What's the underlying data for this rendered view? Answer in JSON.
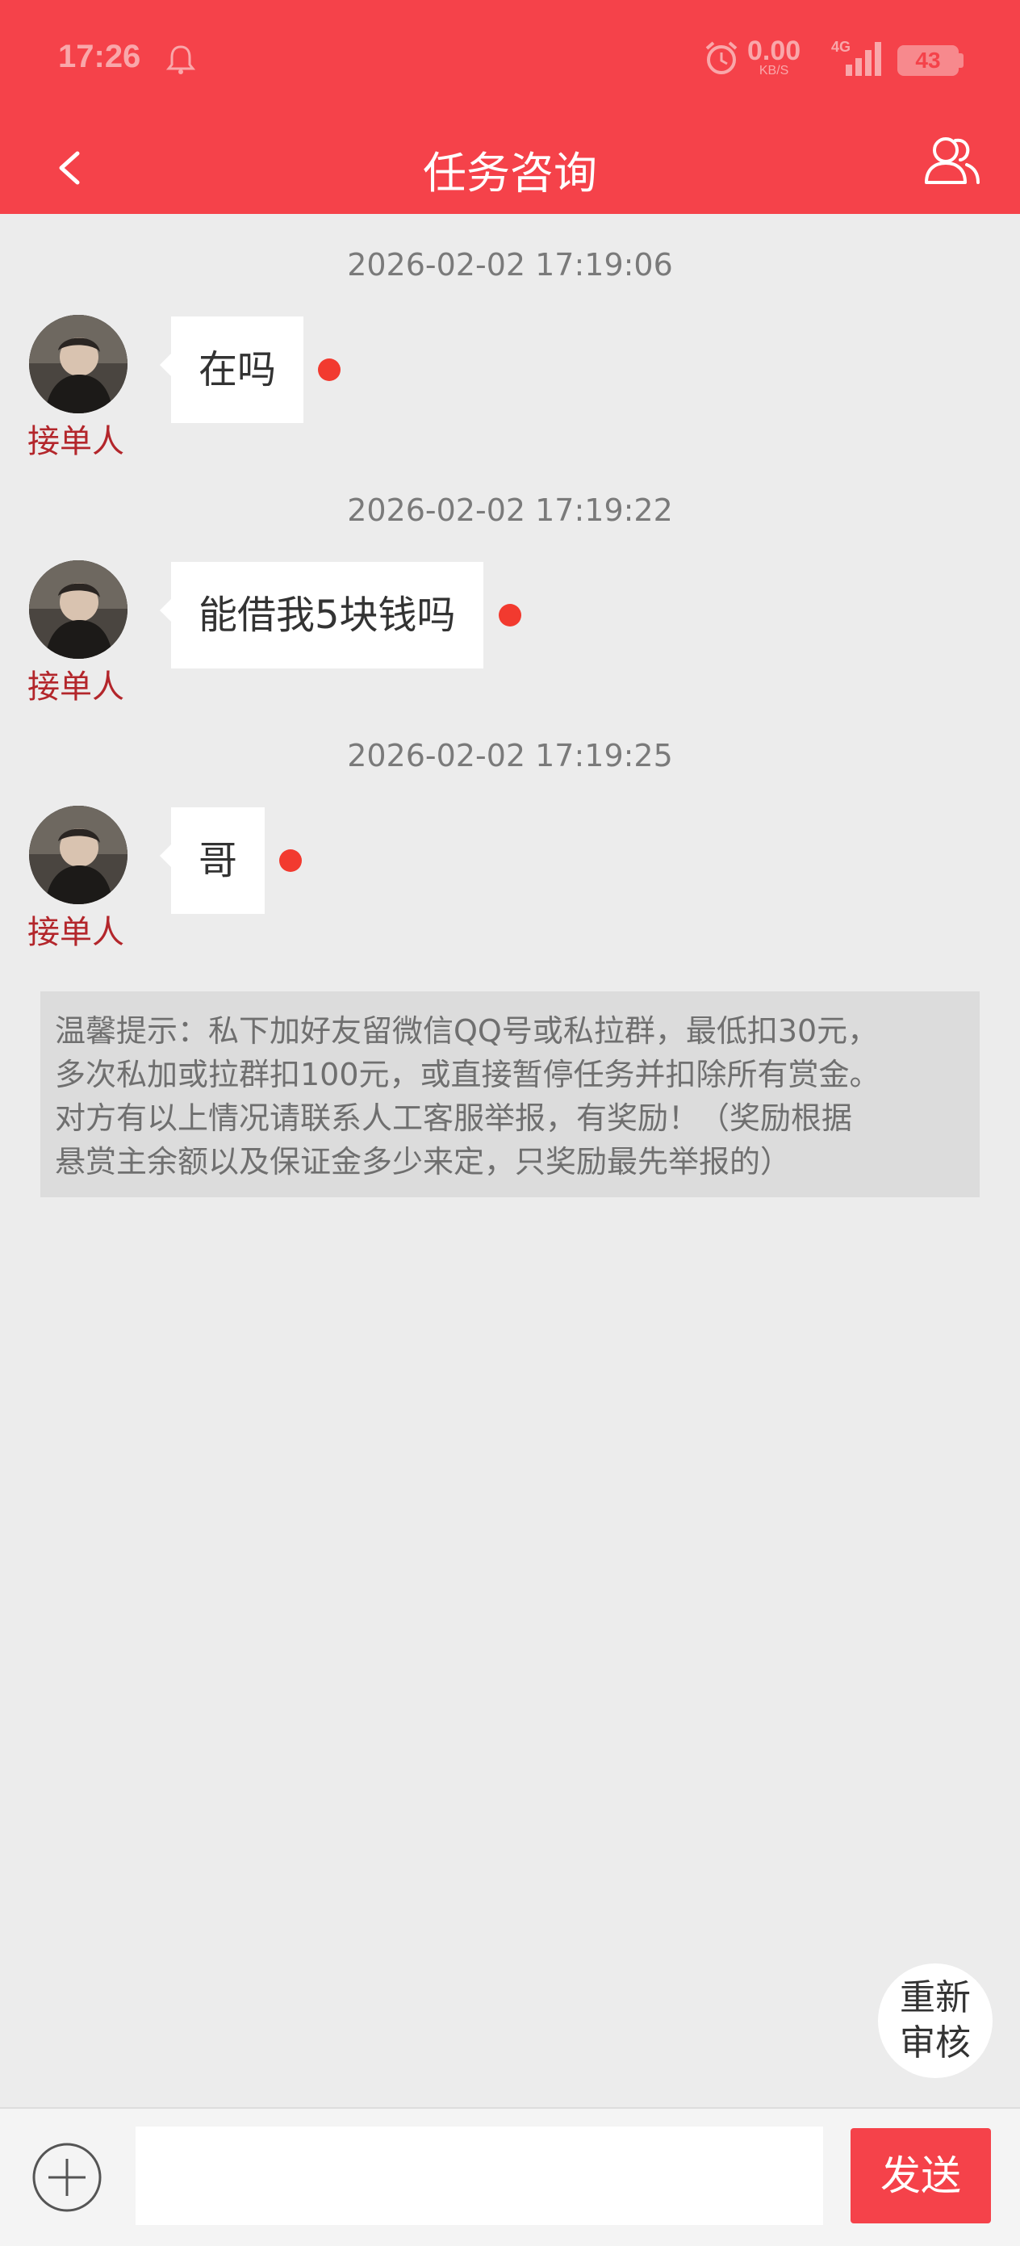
{
  "status_bar": {
    "time": "17:26",
    "net_speed": "0.00",
    "net_unit": "KB/S",
    "network": "4G",
    "battery": "43"
  },
  "header": {
    "title": "任务咨询"
  },
  "messages": [
    {
      "timestamp": "2026-02-02 17:19:06",
      "sender": "接单人",
      "text": "在吗"
    },
    {
      "timestamp": "2026-02-02 17:19:22",
      "sender": "接单人",
      "text": "能借我5块钱吗"
    },
    {
      "timestamp": "2026-02-02 17:19:25",
      "sender": "接单人",
      "text": "哥"
    }
  ],
  "tip": {
    "lines": [
      "温馨提示：私下加好友留微信QQ号或私拉群，最低扣30元，",
      "多次私加或拉群扣100元，或直接暂停任务并扣除所有赏金。",
      "对方有以上情况请联系人工客服举报，有奖励！（奖励根据",
      "悬赏主余额以及保证金多少来定，只奖励最先举报的）"
    ]
  },
  "floating_button": {
    "line1": "重新",
    "line2": "审核"
  },
  "composer": {
    "input_value": "",
    "send_label": "发送"
  },
  "colors": {
    "accent": "#f5424a",
    "role_text": "#b3262b",
    "unread_dot": "#f23a2f",
    "background": "#ececec"
  },
  "icons": [
    "notification-icon",
    "alarm-icon",
    "signal-icon",
    "battery-icon",
    "back-icon",
    "user-icon",
    "plus-icon"
  ]
}
